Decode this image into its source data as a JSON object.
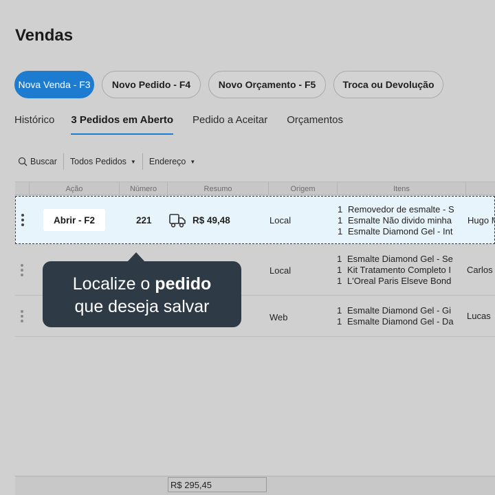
{
  "page": {
    "title": "Vendas"
  },
  "actions": {
    "new_sale": "Nova Venda - F3",
    "new_order": "Novo Pedido - F4",
    "new_quote": "Novo Orçamento - F5",
    "exchange": "Troca ou Devolução"
  },
  "tabs": {
    "history": "Histórico",
    "open_orders": "3 Pedidos em Aberto",
    "to_accept": "Pedido a Aceitar",
    "quotes": "Orçamentos"
  },
  "filters": {
    "search": "Buscar",
    "all_orders": "Todos Pedidos",
    "address": "Endereço"
  },
  "table": {
    "headers": {
      "action": "Ação",
      "number": "Número",
      "summary": "Resumo",
      "origin": "Origem",
      "items": "Itens"
    },
    "rows": [
      {
        "action": "Abrir - F2",
        "number": "221",
        "summary": "R$ 49,48",
        "origin": "Local",
        "items": [
          {
            "qty": "1",
            "name": "Removedor de esmalte - S"
          },
          {
            "qty": "1",
            "name": "Esmalte Não divido minha"
          },
          {
            "qty": "1",
            "name": "Esmalte Diamond Gel - Int"
          }
        ],
        "customer": "Hugo M"
      },
      {
        "origin": "Local",
        "items": [
          {
            "qty": "1",
            "name": "Esmalte Diamond Gel - Se"
          },
          {
            "qty": "1",
            "name": "Kit Tratamento Completo I"
          },
          {
            "qty": "1",
            "name": "L'Oreal Paris Elseve Bond"
          }
        ],
        "customer": "Carlos"
      },
      {
        "origin": "Web",
        "items": [
          {
            "qty": "1",
            "name": "Esmalte Diamond Gel - Gi"
          },
          {
            "qty": "1",
            "name": "Esmalte Diamond Gel - Da"
          }
        ],
        "customer": "Lucas"
      }
    ],
    "total": "R$ 295,45"
  },
  "tooltip": {
    "line1_prefix": "Localize o ",
    "line1_bold": "pedido",
    "line2": "que deseja salvar"
  },
  "colors": {
    "accent": "#1e7cd0",
    "tooltip_bg": "#2e3a45",
    "selected_row": "#e8f4fb"
  }
}
